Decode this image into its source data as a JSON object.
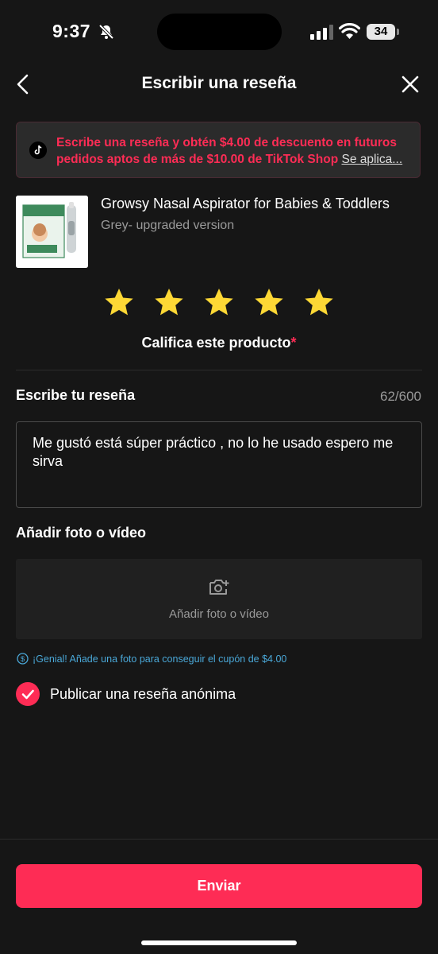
{
  "status_bar": {
    "time": "9:37",
    "battery": "34"
  },
  "header": {
    "title": "Escribir una reseña"
  },
  "promo": {
    "text": "Escribe una reseña y obtén $4.00 de descuento en futuros pedidos aptos de más de $10.00 de TikTok Shop",
    "link": "Se aplica..."
  },
  "product": {
    "name": "Growsy Nasal Aspirator for Babies & Toddlers",
    "variant": "Grey- upgraded version"
  },
  "rating": {
    "value": 5,
    "max": 5,
    "label": "Califica este producto",
    "required_mark": "*"
  },
  "review": {
    "label": "Escribe tu reseña",
    "count": "62/600",
    "text": "Me gustó está súper práctico , no lo he usado espero me sirva"
  },
  "media": {
    "label": "Añadir foto o vídeo",
    "button_label": "Añadir foto o vídeo"
  },
  "tip": {
    "text": "¡Genial! Añade una foto para conseguir el cupón de $4.00"
  },
  "anonymous": {
    "label": "Publicar una reseña anónima",
    "checked": true
  },
  "submit": {
    "label": "Enviar"
  },
  "colors": {
    "accent": "#fe2c55",
    "star": "#fdd835",
    "tip": "#4aa8d8",
    "background": "#161616"
  }
}
